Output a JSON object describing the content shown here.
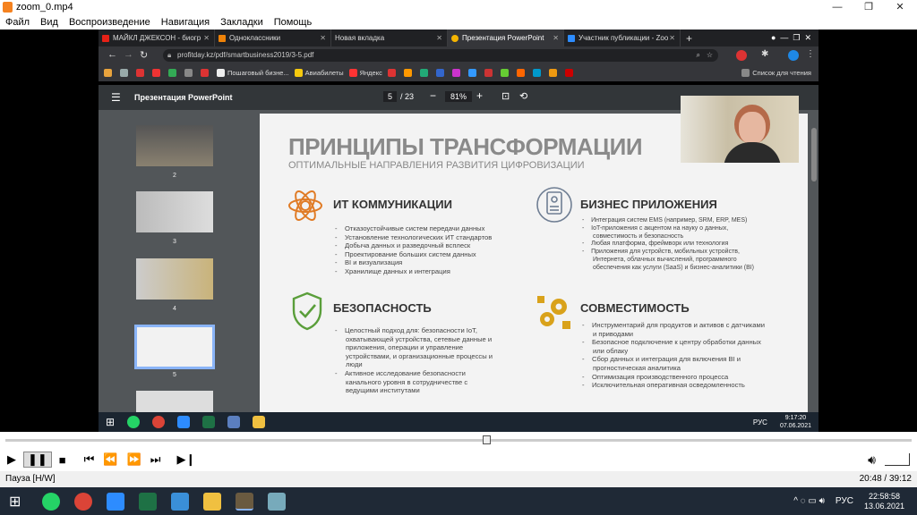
{
  "player": {
    "title": "zoom_0.mp4",
    "menu": [
      "Файл",
      "Вид",
      "Воспроизведение",
      "Навигация",
      "Закладки",
      "Помощь"
    ],
    "status": "Пауза [H/W]",
    "time": "20:48 / 39:12"
  },
  "browser": {
    "tabs": [
      {
        "label": "МАЙКЛ ДЖЕКСОН - биогр",
        "color": "#e62117"
      },
      {
        "label": "Одноклассники",
        "color": "#ee8208"
      },
      {
        "label": "Новая вкладка",
        "color": "#777"
      },
      {
        "label": "Презентация PowerPoint",
        "color": "#f4b400"
      },
      {
        "label": "Участник публикации - Zoo",
        "color": "#2d8cff"
      }
    ],
    "url": "profitday.kz/pdf/smartbusiness2019/3-5.pdf",
    "bookmarks": [
      "Пошаговый бизне...",
      "Авиабилеты",
      "Яндекс"
    ],
    "reading_list": "Список для чтения",
    "pdf": {
      "title": "Презентация PowerPoint",
      "page": "5",
      "pages": "/ 23",
      "zoom": "81%"
    },
    "thumb_nums": [
      "2",
      "3",
      "4",
      "5"
    ]
  },
  "slide": {
    "title": "ПРИНЦИПЫ ТРАНСФОРМАЦИИ",
    "subtitle": "ОПТИМАЛЬНЫЕ НАПРАВЛЕНИЯ РАЗВИТИЯ ЦИФРОВИЗАЦИИ",
    "sections": [
      {
        "heading": "ИТ КОММУНИКАЦИИ",
        "items": [
          "Отказоустойчивые систем передачи данных",
          "Установление технологических ИТ стандартов",
          "Добыча данных и разведочный всплеск",
          "Проектирование больших систем данных",
          "BI и визуализация",
          "Хранилище данных и интеграция"
        ]
      },
      {
        "heading": "БИЗНЕС ПРИЛОЖЕНИЯ",
        "items": [
          "Интеграция систем EMS (например, SRM, ERP, MES)",
          "IoT-приложения с акцентом на науку о данных, совместимость и безопасность",
          "Любая платформа, фреймворк или технология",
          "Приложения для устройств, мобильных устройств, Интернета, облачных вычислений, программного обеспечения как услуги (SaaS) и бизнес-аналитики (BI)"
        ]
      },
      {
        "heading": "БЕЗОПАСНОСТЬ",
        "items": [
          "Целостный подход для: безопасности IoT, охватывающей устройства, сетевые данные и приложения, операции и управление устройствами, и организационные процессы и люди",
          "Активное исследование безопасности канального уровня в  сотрудничестве с ведущими институтами"
        ]
      },
      {
        "heading": "СОВМЕСТИМОСТЬ",
        "items": [
          "Инструментарий для продуктов и активов с датчиками и приводами",
          "Безопасное подключение к центру обработки данных или облаку",
          "Сбор данных и интеграция для включения BI и прогностическая аналитика",
          "Оптимизация производственного процесса",
          "Исключительная оперативная осведомленность"
        ]
      }
    ]
  },
  "inner_clock": {
    "time": "9:17:20",
    "date": "07.06.2021",
    "lang": "РУС"
  },
  "taskbar": {
    "time": "22:58:58",
    "date": "13.06.2021",
    "lang": "РУС"
  },
  "colors": {
    "orange": "#e07b25",
    "green": "#5a9e3a",
    "gold": "#d9a21b",
    "slate": "#6f7e93"
  }
}
